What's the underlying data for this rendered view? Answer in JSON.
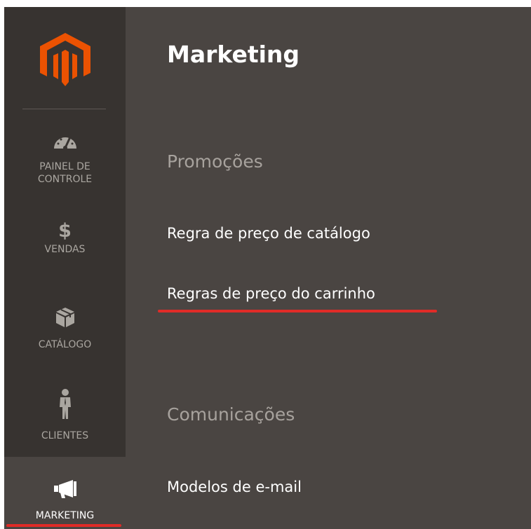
{
  "sidebar": {
    "logo_icon": "magento-logo-icon",
    "items": [
      {
        "label": "PAINEL DE\nCONTROLE",
        "icon": "dashboard-gauge-icon"
      },
      {
        "label": "VENDAS",
        "icon": "dollar-icon",
        "glyph": "$"
      },
      {
        "label": "CATÁLOGO",
        "icon": "box-icon"
      },
      {
        "label": "CLIENTES",
        "icon": "person-icon"
      },
      {
        "label": "MARKETING",
        "icon": "megaphone-icon",
        "active": true
      }
    ]
  },
  "flyout": {
    "title": "Marketing",
    "sections": [
      {
        "title": "Promoções",
        "links": [
          "Regra de preço de catálogo",
          "Regras de preço do carrinho"
        ]
      },
      {
        "title": "Comunicações",
        "links": [
          "Modelos de e-mail"
        ]
      }
    ]
  },
  "colors": {
    "sidebar_bg": "#373330",
    "flyout_bg": "#4a4542",
    "logo_orange": "#eb5202",
    "highlight_red": "#e02b27",
    "muted_text": "#a7a29d"
  }
}
